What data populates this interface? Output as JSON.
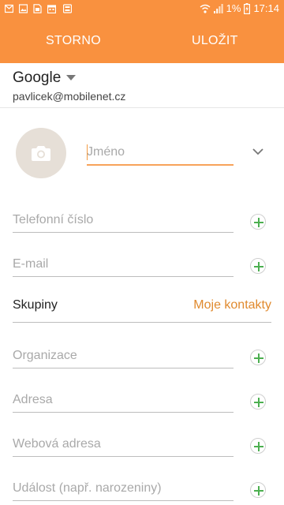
{
  "status_bar": {
    "battery": "1%",
    "time": "17:14",
    "icons": [
      "mail-icon",
      "image-icon",
      "sim-icon",
      "calendar-icon",
      "storage-icon",
      "wifi-icon",
      "signal-icon",
      "battery-charging-icon"
    ]
  },
  "actionbar": {
    "cancel_label": "STORNO",
    "save_label": "ULOŽIT"
  },
  "account": {
    "type": "Google",
    "email": "pavlicek@mobilenet.cz"
  },
  "name_field": {
    "placeholder": "Jméno"
  },
  "fields": {
    "phone": {
      "placeholder": "Telefonní číslo"
    },
    "email": {
      "placeholder": "E-mail"
    },
    "organization": {
      "placeholder": "Organizace"
    },
    "address": {
      "placeholder": "Adresa"
    },
    "website": {
      "placeholder": "Webová adresa"
    },
    "event": {
      "placeholder": "Událost (např. narozeniny)"
    }
  },
  "groups": {
    "label": "Skupiny",
    "value": "Moje kontakty"
  },
  "colors": {
    "accent": "#f9913f",
    "group_value": "#e08a2e",
    "plus": "#4caf50"
  }
}
